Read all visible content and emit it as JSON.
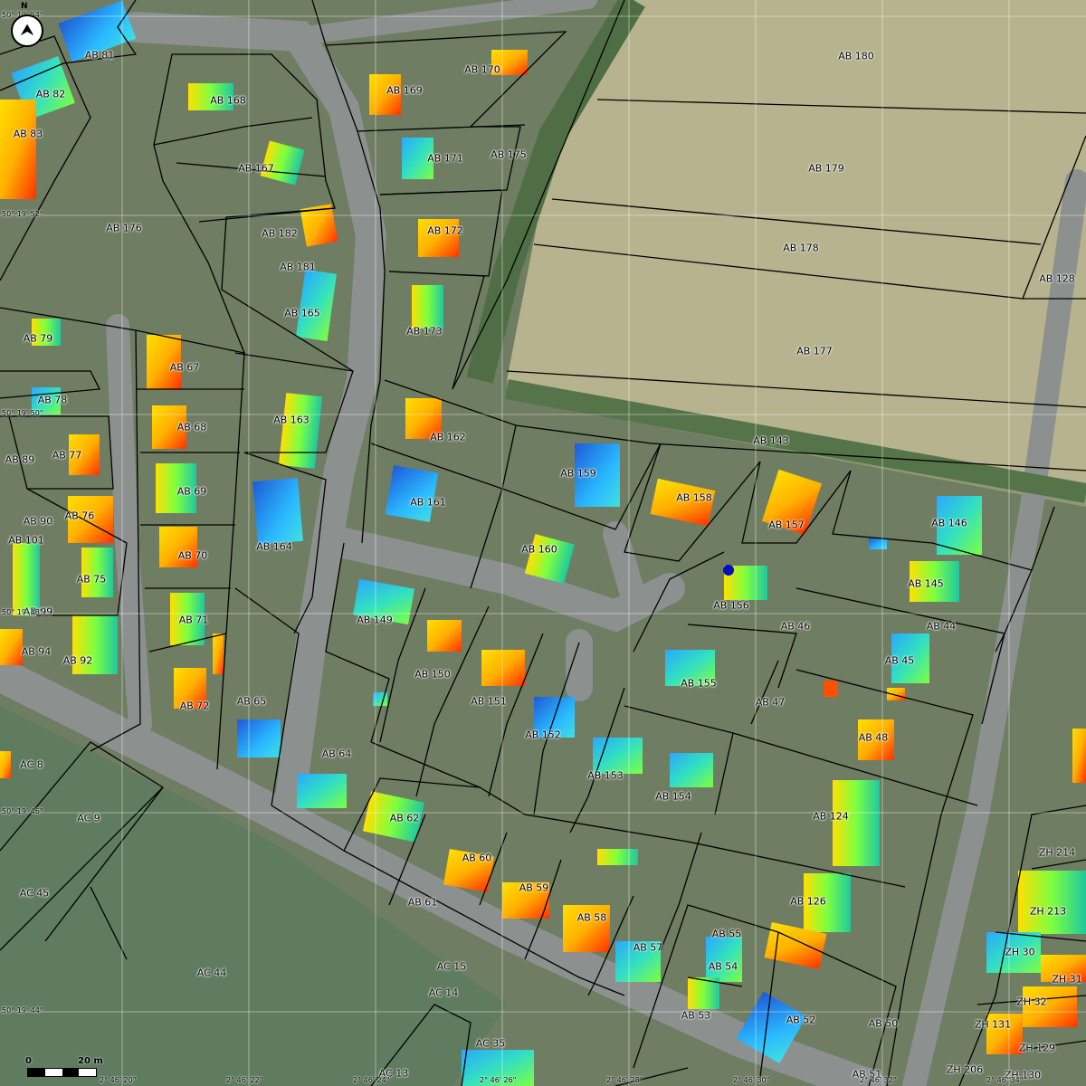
{
  "parcels": [
    {
      "id": "AB 81",
      "kind": "parcel"
    },
    {
      "id": "AB 82",
      "kind": "parcel"
    },
    {
      "id": "AB 83",
      "kind": "parcel"
    },
    {
      "id": "AB 168",
      "kind": "parcel"
    },
    {
      "id": "AB 169",
      "kind": "parcel"
    },
    {
      "id": "AB 170",
      "kind": "parcel"
    },
    {
      "id": "AB 180",
      "kind": "parcel"
    },
    {
      "id": "AB 167",
      "kind": "parcel"
    },
    {
      "id": "AB 171",
      "kind": "parcel"
    },
    {
      "id": "AB 175",
      "kind": "parcel"
    },
    {
      "id": "AB 179",
      "kind": "parcel"
    },
    {
      "id": "AB 176",
      "kind": "parcel"
    },
    {
      "id": "AB 182",
      "kind": "parcel"
    },
    {
      "id": "AB 172",
      "kind": "parcel"
    },
    {
      "id": "AB 178",
      "kind": "parcel"
    },
    {
      "id": "AB 181",
      "kind": "parcel"
    },
    {
      "id": "AB 128",
      "kind": "parcel"
    },
    {
      "id": "AB 165",
      "kind": "parcel"
    },
    {
      "id": "AB 173",
      "kind": "parcel"
    },
    {
      "id": "AB 79",
      "kind": "parcel"
    },
    {
      "id": "AB 177",
      "kind": "parcel"
    },
    {
      "id": "AB 67",
      "kind": "parcel"
    },
    {
      "id": "AB 78",
      "kind": "parcel"
    },
    {
      "id": "AB 163",
      "kind": "parcel"
    },
    {
      "id": "AB 68",
      "kind": "parcel"
    },
    {
      "id": "AB 162",
      "kind": "parcel"
    },
    {
      "id": "AB 143",
      "kind": "parcel"
    },
    {
      "id": "AB 77",
      "kind": "parcel"
    },
    {
      "id": "AB 89",
      "kind": "parcel"
    },
    {
      "id": "AB 159",
      "kind": "parcel"
    },
    {
      "id": "AB 69",
      "kind": "parcel"
    },
    {
      "id": "AB 161",
      "kind": "parcel"
    },
    {
      "id": "AB 158",
      "kind": "parcel"
    },
    {
      "id": "AB 76",
      "kind": "parcel"
    },
    {
      "id": "AB 90",
      "kind": "parcel"
    },
    {
      "id": "AB 157",
      "kind": "parcel"
    },
    {
      "id": "AB 146",
      "kind": "parcel"
    },
    {
      "id": "AB 101",
      "kind": "parcel"
    },
    {
      "id": "AB 164",
      "kind": "parcel"
    },
    {
      "id": "AB 160",
      "kind": "parcel"
    },
    {
      "id": "AB 70",
      "kind": "parcel"
    },
    {
      "id": "AB 75",
      "kind": "parcel"
    },
    {
      "id": "AB 145",
      "kind": "parcel"
    },
    {
      "id": "AB 156",
      "kind": "parcel"
    },
    {
      "id": "AB 99",
      "kind": "parcel"
    },
    {
      "id": "AB 149",
      "kind": "parcel"
    },
    {
      "id": "AB 71",
      "kind": "parcel"
    },
    {
      "id": "AB 46",
      "kind": "parcel"
    },
    {
      "id": "AB 44",
      "kind": "parcel"
    },
    {
      "id": "AB 94",
      "kind": "parcel"
    },
    {
      "id": "AB 92",
      "kind": "parcel"
    },
    {
      "id": "AB 150",
      "kind": "parcel"
    },
    {
      "id": "AB 45",
      "kind": "parcel"
    },
    {
      "id": "AB 155",
      "kind": "parcel"
    },
    {
      "id": "AB 72",
      "kind": "parcel"
    },
    {
      "id": "AB 65",
      "kind": "parcel"
    },
    {
      "id": "AB 151",
      "kind": "parcel"
    },
    {
      "id": "AB 47",
      "kind": "parcel"
    },
    {
      "id": "AB 152",
      "kind": "parcel"
    },
    {
      "id": "AB 48",
      "kind": "parcel"
    },
    {
      "id": "AB 64",
      "kind": "parcel"
    },
    {
      "id": "AC 8",
      "kind": "parcel"
    },
    {
      "id": "AB 153",
      "kind": "parcel"
    },
    {
      "id": "AB 154",
      "kind": "parcel"
    },
    {
      "id": "AC 9",
      "kind": "parcel"
    },
    {
      "id": "AB 62",
      "kind": "parcel"
    },
    {
      "id": "AB 124",
      "kind": "parcel"
    },
    {
      "id": "ZH 214",
      "kind": "parcel"
    },
    {
      "id": "AB 60",
      "kind": "parcel"
    },
    {
      "id": "AC 45",
      "kind": "parcel"
    },
    {
      "id": "AB 59",
      "kind": "parcel"
    },
    {
      "id": "AB 61",
      "kind": "parcel"
    },
    {
      "id": "AB 126",
      "kind": "parcel"
    },
    {
      "id": "ZH 213",
      "kind": "parcel"
    },
    {
      "id": "AB 58",
      "kind": "parcel"
    },
    {
      "id": "AB 55",
      "kind": "parcel"
    },
    {
      "id": "AB 57",
      "kind": "parcel"
    },
    {
      "id": "ZH 30",
      "kind": "parcel"
    },
    {
      "id": "AB 54",
      "kind": "parcel"
    },
    {
      "id": "AC 15",
      "kind": "parcel"
    },
    {
      "id": "AC 44",
      "kind": "parcel"
    },
    {
      "id": "ZH 31",
      "kind": "parcel"
    },
    {
      "id": "AC 14",
      "kind": "parcel"
    },
    {
      "id": "AB 53",
      "kind": "parcel"
    },
    {
      "id": "ZH 32",
      "kind": "parcel"
    },
    {
      "id": "AB 52",
      "kind": "parcel"
    },
    {
      "id": "AB 50",
      "kind": "parcel"
    },
    {
      "id": "ZH 131",
      "kind": "parcel"
    },
    {
      "id": "ZH 129",
      "kind": "parcel"
    },
    {
      "id": "AC 35",
      "kind": "parcel"
    },
    {
      "id": "AC 13",
      "kind": "parcel"
    },
    {
      "id": "AB 51",
      "kind": "parcel"
    },
    {
      "id": "ZH 206",
      "kind": "parcel"
    },
    {
      "id": "ZH 130",
      "kind": "parcel"
    }
  ],
  "coordinates": {
    "lat": [
      "50° 19' 54\"",
      "50° 19' 52\"",
      "50° 19' 50\"",
      "50° 19' 48\"",
      "50° 19' 46\"",
      "50° 19' 44\""
    ],
    "lon": [
      "2° 46' 20\"",
      "2° 46' 22\"",
      "2° 46' 24\"",
      "2° 46' 26\"",
      "2° 46' 28\"",
      "2° 46' 30\"",
      "2° 46' 32\"",
      "2° 46' 34\""
    ]
  },
  "north_arrow": {
    "letter": "N",
    "icon": "north-arrow-icon"
  },
  "scale_bar": {
    "start": "0",
    "end": "20 m"
  },
  "colors": {
    "boundary": "#000000",
    "grid": "#ffffff",
    "field": "#b9b58f",
    "heat_low": "#1e5bd6",
    "heat_mid": "#33e06a",
    "heat_high": "#ffe000",
    "heat_peak": "#ff2a00"
  }
}
